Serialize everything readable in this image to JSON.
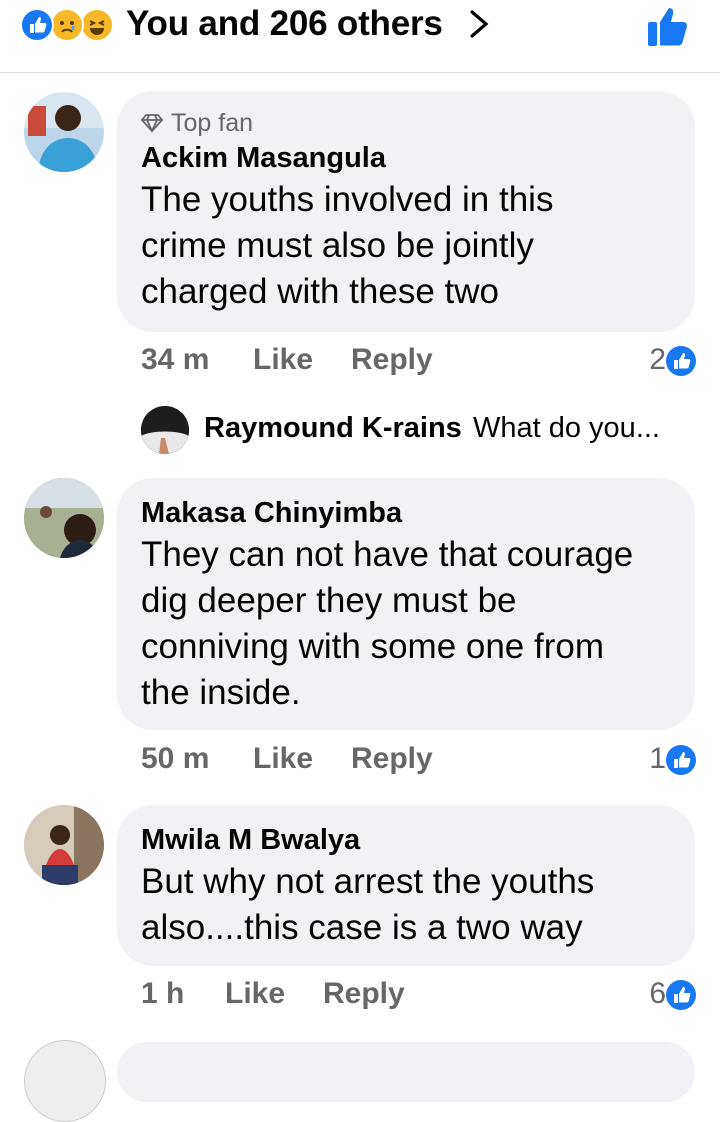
{
  "header": {
    "title": "You and 206 others",
    "reaction_icons": [
      "like-reaction-icon",
      "sad-reaction-icon",
      "haha-reaction-icon"
    ],
    "accent_color": "#1877f2"
  },
  "comments": [
    {
      "badge": "Top fan",
      "author": "Ackim Masangula",
      "text_lines": [
        "The youths involved in this",
        "crime must also be jointly",
        "charged with these two"
      ],
      "time": "34 m",
      "like_label": "Like",
      "reply_label": "Reply",
      "reaction_count": "2"
    },
    {
      "author": "Makasa Chinyimba",
      "text_lines": [
        "They can not have that courage",
        "dig deeper they must be",
        "conniving with some one from",
        "the inside."
      ],
      "time": "50 m",
      "like_label": "Like",
      "reply_label": "Reply",
      "reaction_count": "1"
    },
    {
      "author": "Mwila M Bwalya",
      "text_lines": [
        "But why not arrest the youths",
        "also....this case is a two way"
      ],
      "time": "1 h",
      "like_label": "Like",
      "reply_label": "Reply",
      "reaction_count": "6"
    }
  ],
  "reply_preview": {
    "author": "Raymound K-rains",
    "text": "What do you..."
  }
}
